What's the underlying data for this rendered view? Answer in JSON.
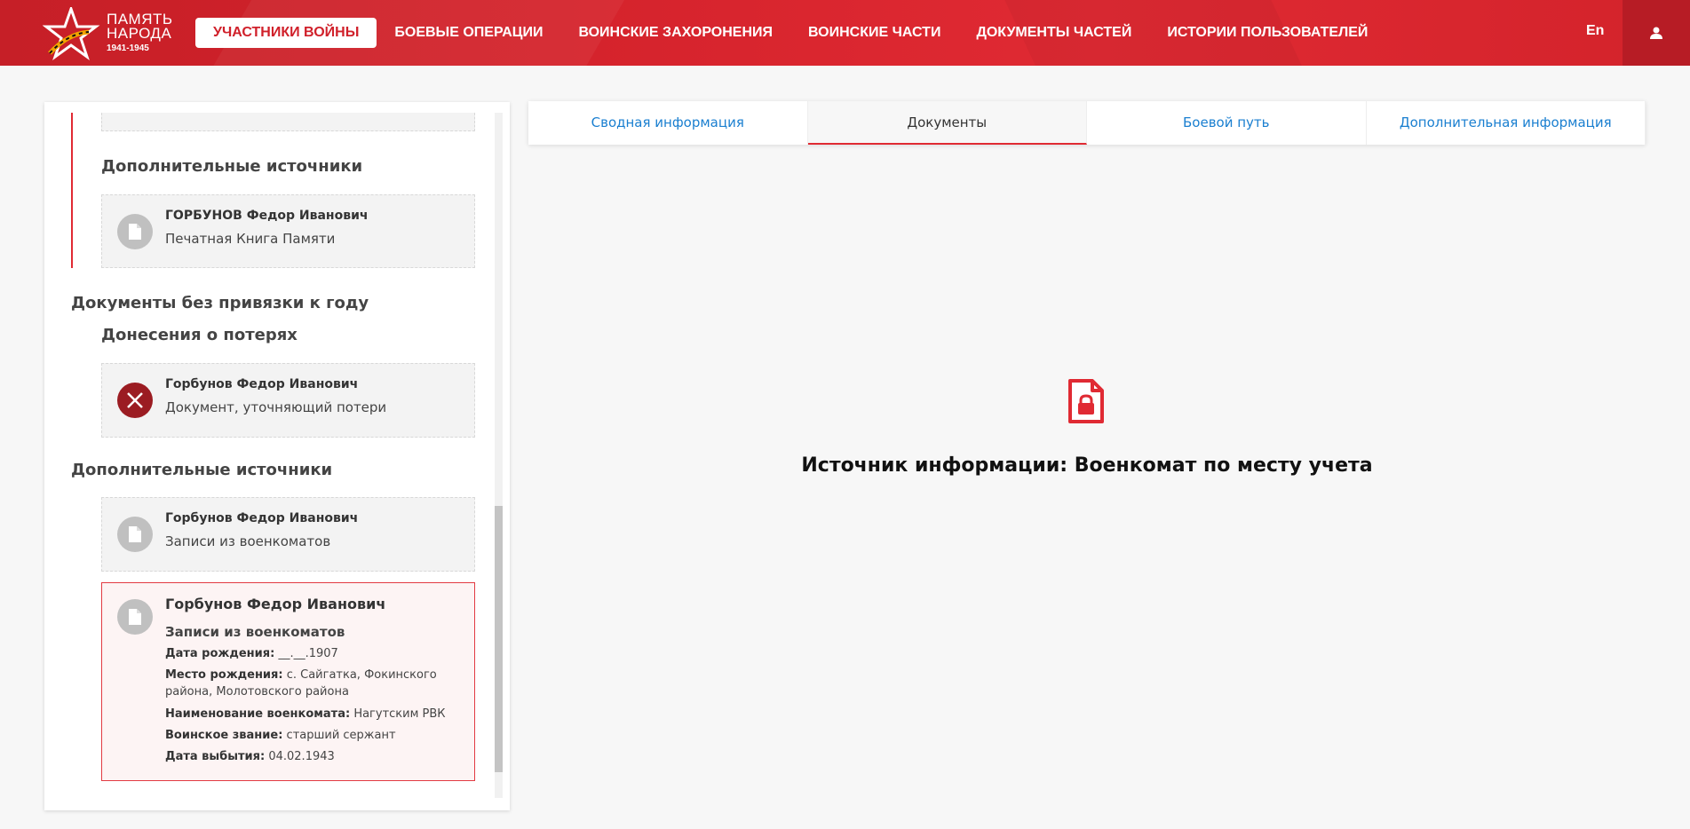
{
  "logo": {
    "line1": "ПАМЯТЬ",
    "line2": "НАРОДА",
    "years": "1941-1945"
  },
  "nav": [
    {
      "label": "УЧАСТНИКИ ВОЙНЫ"
    },
    {
      "label": "БОЕВЫЕ ОПЕРАЦИИ"
    },
    {
      "label": "ВОИНСКИЕ ЗАХОРОНЕНИЯ"
    },
    {
      "label": "ВОИНСКИЕ ЧАСТИ"
    },
    {
      "label": "ДОКУМЕНТЫ ЧАСТЕЙ"
    },
    {
      "label": "ИСТОРИИ ПОЛЬЗОВАТЕЛЕЙ"
    }
  ],
  "lang": "En",
  "left": {
    "extra_sources_1": "Дополнительные источники",
    "card1": {
      "name": "ГОРБУНОВ Федор Иванович",
      "sub": "Печатная Книга Памяти"
    },
    "no_year": "Документы без привязки к году",
    "losses": "Донесения о потерях",
    "card2": {
      "name": "Горбунов Федор Иванович",
      "sub": "Документ, уточняющий потери"
    },
    "extra_sources_2": "Дополнительные источники",
    "card3": {
      "name": "Горбунов Федор Иванович",
      "sub": "Записи из военкоматов"
    },
    "selected": {
      "name": "Горбунов Федор Иванович",
      "subtitle": "Записи из военкоматов",
      "birth_label": "Дата рождения:",
      "birth_value": "__.__.1907",
      "place_label": "Место рождения:",
      "place_value": "с. Сайгатка, Фокинского района, Молотовского района",
      "office_label": "Наименование военкомата:",
      "office_value": "Нагутским РВК",
      "rank_label": "Воинское звание:",
      "rank_value": "старший сержант",
      "leave_label": "Дата выбытия:",
      "leave_value": "04.02.1943"
    }
  },
  "tabs": [
    {
      "label": "Сводная информация"
    },
    {
      "label": "Документы"
    },
    {
      "label": "Боевой путь"
    },
    {
      "label": "Дополнительная информация"
    }
  ],
  "main": {
    "message": "Источник информации: Военкомат по месту учета"
  },
  "colors": {
    "brand_red": "#d5232c",
    "link_blue": "#1a7fd0",
    "selected_border": "#e23a42"
  }
}
